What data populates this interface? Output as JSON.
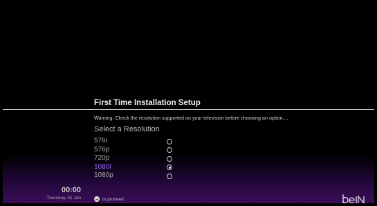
{
  "setup": {
    "title": "First Time Installation Setup",
    "warning": "Warning: Check the resolution supported on your television before choosing an option....",
    "section_title": "Select a Resolution"
  },
  "resolutions": [
    {
      "label": "576i",
      "selected": false
    },
    {
      "label": "576p",
      "selected": false
    },
    {
      "label": "720p",
      "selected": false
    },
    {
      "label": "1080i",
      "selected": true
    },
    {
      "label": "1080p",
      "selected": false
    }
  ],
  "status": {
    "time": "00:00",
    "date": "Thursday, 01 Jan"
  },
  "hint": {
    "icon": "ok-button-icon",
    "icon_text": "OK",
    "text": "to proceed"
  },
  "branding": {
    "logo_text": "beIN",
    "logo_icon": "bein-logo-icon"
  },
  "colors": {
    "accent": "#9a6dff",
    "background": "#000000",
    "footer_gradient": "#3a0d5a"
  }
}
